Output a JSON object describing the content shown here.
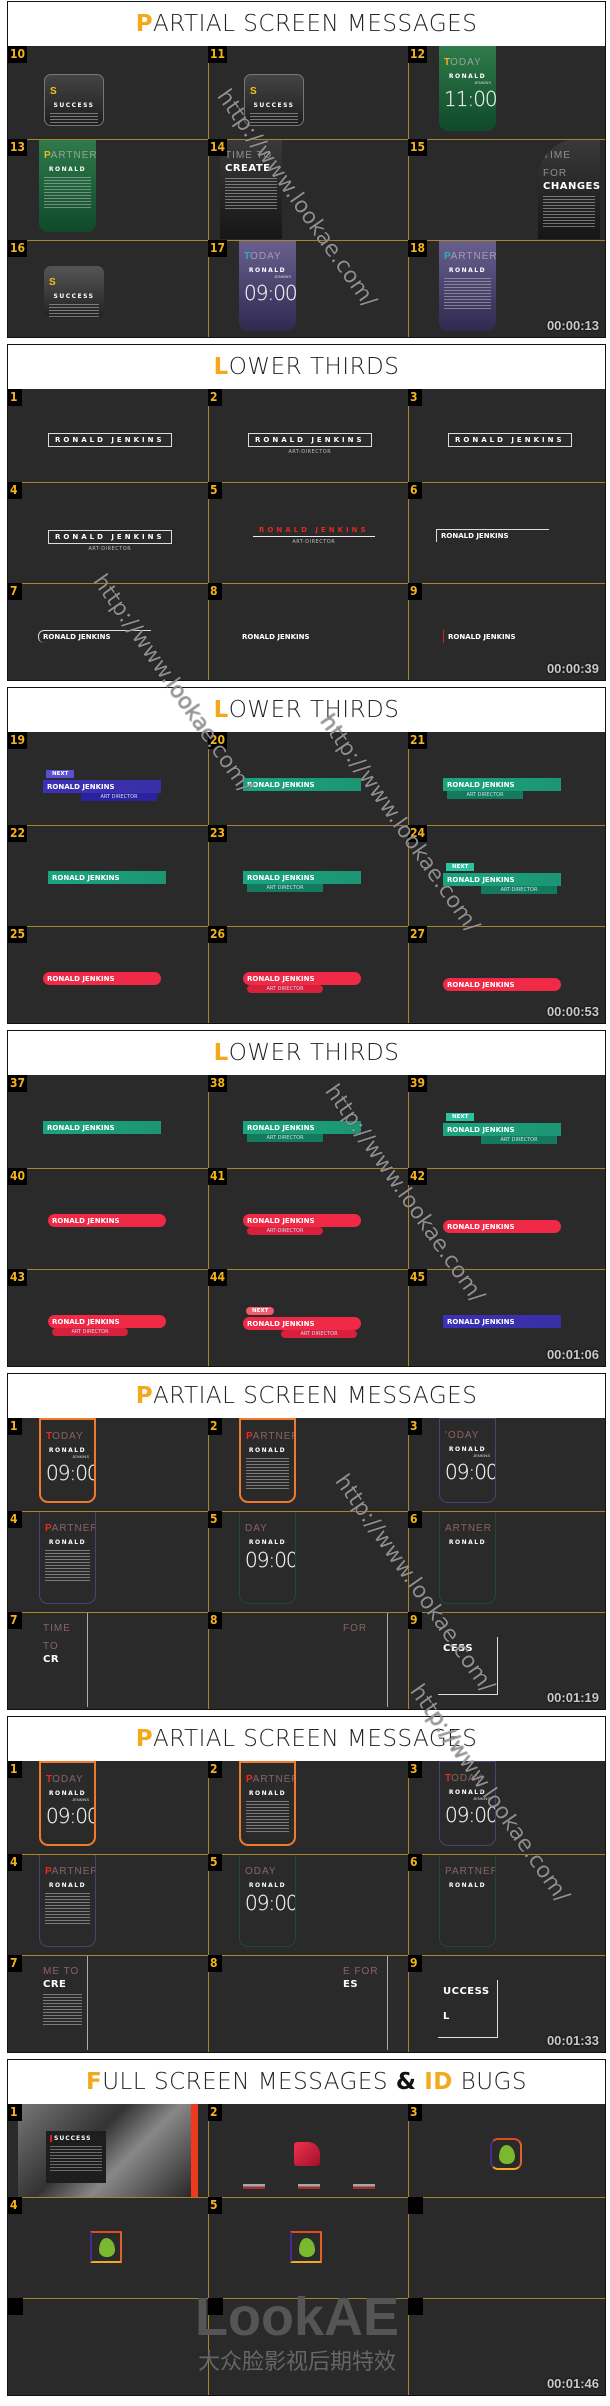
{
  "colors": {
    "accent": "#f4a81c",
    "grid_line": "#a8852c",
    "cell_bg": "#2a2a2a",
    "green": "#1aa57e",
    "blue": "#3b30b8",
    "red": "#f02a46",
    "orange": "#f07a2a",
    "purple": "#4a4470"
  },
  "watermark": {
    "url": "http://www.lookae.com/",
    "logo": "LookAE",
    "logo_sub": "大众脸影视后期特效"
  },
  "sections": [
    {
      "heading": [
        {
          "t": "P",
          "s": "accent"
        },
        {
          "t": "ARTIAL SCREEN MESSAGES",
          "s": "plain"
        }
      ],
      "timestamp": "00:00:13",
      "cells": [
        {
          "n": "10",
          "kind": "card",
          "theme": "dark",
          "ha": "S",
          "hr": "",
          "title": "SUCCESS",
          "para": true
        },
        {
          "n": "11",
          "kind": "card",
          "theme": "dark",
          "ha": "S",
          "title": "SUCCESS",
          "para": true
        },
        {
          "n": "12",
          "kind": "card",
          "theme": "green",
          "ha": "T",
          "hr": "ODAY",
          "title": "RONALD",
          "sub": "JENKINS",
          "time": "11:00"
        },
        {
          "n": "13",
          "kind": "card",
          "theme": "green",
          "ha": "P",
          "hr": "ARTNER",
          "title": "RONALD",
          "para": true
        },
        {
          "n": "14",
          "kind": "card",
          "theme": "black",
          "hr": "TIME TO",
          "big": "CREATE",
          "para": true
        },
        {
          "n": "15",
          "kind": "card",
          "theme": "black",
          "hr": "TIME FOR",
          "big": "CHANGES",
          "para": true
        },
        {
          "n": "16",
          "kind": "card",
          "theme": "gray",
          "ha": "S",
          "title": "SUCCESS",
          "para": true
        },
        {
          "n": "17",
          "kind": "card",
          "theme": "purple",
          "ha": "T",
          "hr": "ODAY",
          "title": "RONALD",
          "sub": "JENKINS",
          "time": "09:00"
        },
        {
          "n": "18",
          "kind": "card",
          "theme": "purple",
          "ha": "P",
          "hr": "ARTNER",
          "title": "RONALD",
          "para": true
        }
      ]
    },
    {
      "heading": [
        {
          "t": "L",
          "s": "accent"
        },
        {
          "t": "OWER THIRDS",
          "s": "plain"
        }
      ],
      "timestamp": "00:00:39",
      "cells": [
        {
          "n": "1",
          "kind": "lower",
          "style": "box",
          "name": "RONALD JENKINS"
        },
        {
          "n": "2",
          "kind": "lower",
          "style": "box",
          "name": "RONALD JENKINS",
          "sub": "ART-DIRECTOR"
        },
        {
          "n": "3",
          "kind": "lower",
          "style": "box",
          "name": "RONALD JENKINS"
        },
        {
          "n": "4",
          "kind": "lower",
          "style": "box",
          "name": "RONALD JENKINS",
          "sub": "ART-DIRECTOR"
        },
        {
          "n": "5",
          "kind": "lower",
          "style": "redtext",
          "name": "RONALD JENKINS",
          "sub": "ART-DIRECTOR"
        },
        {
          "n": "6",
          "kind": "lower",
          "style": "line",
          "name": "RONALD JENKINS"
        },
        {
          "n": "7",
          "kind": "lower",
          "style": "line",
          "name": "RONALD JENKINS"
        },
        {
          "n": "8",
          "kind": "lower",
          "style": "plain",
          "name": "RONALD JENKINS"
        },
        {
          "n": "9",
          "kind": "lower",
          "style": "redmark",
          "name": "RONALD JENKINS"
        }
      ]
    },
    {
      "heading": [
        {
          "t": "L",
          "s": "accent"
        },
        {
          "t": "OWER THIRDS",
          "s": "plain"
        }
      ],
      "timestamp": "00:00:53",
      "cells": [
        {
          "n": "19",
          "kind": "lower",
          "style": "bar",
          "color": "blue",
          "name": "RONALD JENKINS",
          "sub": "ART DIRECTOR",
          "next": "NEXT"
        },
        {
          "n": "20",
          "kind": "lower",
          "style": "bar",
          "color": "green",
          "name": "RONALD JENKINS"
        },
        {
          "n": "21",
          "kind": "lower",
          "style": "bar",
          "color": "green",
          "name": "RONALD JENKINS",
          "sub": "ART DIRECTOR"
        },
        {
          "n": "22",
          "kind": "lower",
          "style": "bar",
          "color": "green",
          "name": "RONALD JENKINS"
        },
        {
          "n": "23",
          "kind": "lower",
          "style": "bar",
          "color": "green",
          "name": "RONALD JENKINS",
          "sub": "ART DIRECTOR"
        },
        {
          "n": "24",
          "kind": "lower",
          "style": "bar",
          "color": "green",
          "name": "RONALD JENKINS",
          "sub": "ART-DIRECTOR",
          "next": "NEXT"
        },
        {
          "n": "25",
          "kind": "lower",
          "style": "bar",
          "color": "red",
          "name": "RONALD JENKINS",
          "tab": "pill"
        },
        {
          "n": "26",
          "kind": "lower",
          "style": "bar",
          "color": "red",
          "name": "RONALD JENKINS",
          "sub": "ART DIRECTOR",
          "tab": "pill"
        },
        {
          "n": "27",
          "kind": "lower",
          "style": "bar",
          "color": "red",
          "name": "RONALD JENKINS",
          "tab": "pill"
        }
      ]
    },
    {
      "heading": [
        {
          "t": "L",
          "s": "accent"
        },
        {
          "t": "OWER THIRDS",
          "s": "plain"
        }
      ],
      "timestamp": "00:01:06",
      "cells": [
        {
          "n": "37",
          "kind": "lower",
          "style": "bar",
          "color": "green",
          "name": "RONALD JENKINS",
          "tab": "white"
        },
        {
          "n": "38",
          "kind": "lower",
          "style": "bar",
          "color": "green",
          "name": "RONALD JENKINS",
          "sub": "ART DIRECTOR",
          "tab": "white"
        },
        {
          "n": "39",
          "kind": "lower",
          "style": "bar",
          "color": "green",
          "name": "RONALD JENKINS",
          "sub": "ART DIRECTOR",
          "next": "NEXT",
          "tab": "white"
        },
        {
          "n": "40",
          "kind": "lower",
          "style": "bar",
          "color": "red",
          "name": "RONALD JENKINS",
          "tab": "icon"
        },
        {
          "n": "41",
          "kind": "lower",
          "style": "bar",
          "color": "red",
          "name": "RONALD JENKINS",
          "sub": "ART-DIRECTOR",
          "tab": "icon"
        },
        {
          "n": "42",
          "kind": "lower",
          "style": "bar",
          "color": "red",
          "name": "RONALD JENKINS",
          "tab": "icon"
        },
        {
          "n": "43",
          "kind": "lower",
          "style": "bar",
          "color": "red",
          "name": "RONALD JENKINS",
          "sub": "ART DIRECTOR",
          "tab": "icon"
        },
        {
          "n": "44",
          "kind": "lower",
          "style": "bar",
          "color": "red",
          "name": "RONALD JENKINS",
          "sub": "ART DIRECTOR",
          "next": "NEXT",
          "tab": "icon"
        },
        {
          "n": "45",
          "kind": "lower",
          "style": "bar",
          "color": "blue",
          "name": "RONALD JENKINS",
          "tab": "leaf"
        }
      ]
    },
    {
      "heading": [
        {
          "t": "P",
          "s": "accent"
        },
        {
          "t": "ARTIAL SCREEN MESSAGES",
          "s": "plain"
        }
      ],
      "timestamp": "00:01:19",
      "cells": [
        {
          "n": "1",
          "kind": "card",
          "theme": "o-orange",
          "ha": "T",
          "hr": "ODAY",
          "title": "RONALD",
          "sub": "JENKINS",
          "time": "09:00"
        },
        {
          "n": "2",
          "kind": "card",
          "theme": "o-orange",
          "ha": "P",
          "hr": "ARTNER",
          "title": "RONALD",
          "para": true
        },
        {
          "n": "3",
          "kind": "card",
          "theme": "o-purple",
          "hr": "'ODAY",
          "title": "RONALD",
          "sub": "JENKINS",
          "time": "09:00"
        },
        {
          "n": "4",
          "kind": "card",
          "theme": "o-purple",
          "ha": "P",
          "hr": "ARTNER",
          "title": "RONALD",
          "para": true
        },
        {
          "n": "5",
          "kind": "card",
          "theme": "o-green",
          "hr": "DAY",
          "title": "RONALD",
          "time": "09:00"
        },
        {
          "n": "6",
          "kind": "card",
          "theme": "o-green",
          "hr": "ARTNER",
          "title": "RONALD"
        },
        {
          "n": "7",
          "kind": "card",
          "theme": "o-line",
          "hr": "TIME TO",
          "big": "CR"
        },
        {
          "n": "8",
          "kind": "card",
          "theme": "o-line",
          "hr": "FOR"
        },
        {
          "n": "9",
          "kind": "card",
          "theme": "o-corner",
          "big": "CESS"
        }
      ]
    },
    {
      "heading": [
        {
          "t": "P",
          "s": "accent"
        },
        {
          "t": "ARTIAL SCREEN MESSAGES",
          "s": "plain"
        }
      ],
      "timestamp": "00:01:33",
      "cells": [
        {
          "n": "1",
          "kind": "card",
          "theme": "o-orange",
          "ha": "T",
          "hr": "ODAY",
          "title": "RONALD",
          "sub": "JENKINS",
          "time": "09:00"
        },
        {
          "n": "2",
          "kind": "card",
          "theme": "o-orange",
          "ha": "P",
          "hr": "ARTNER",
          "title": "RONALD",
          "para": true
        },
        {
          "n": "3",
          "kind": "card",
          "theme": "o-purple",
          "ha": "T",
          "hr": "ODAY",
          "title": "RONALD",
          "sub": "JENKINS",
          "time": "09:00"
        },
        {
          "n": "4",
          "kind": "card",
          "theme": "o-purple",
          "ha": "P",
          "hr": "ARTNER",
          "title": "RONALD",
          "para": true
        },
        {
          "n": "5",
          "kind": "card",
          "theme": "o-green",
          "hr": "ODAY",
          "title": "RONALD",
          "time": "09:00"
        },
        {
          "n": "6",
          "kind": "card",
          "theme": "o-green",
          "hr": "PARTNER",
          "title": "RONALD"
        },
        {
          "n": "7",
          "kind": "card",
          "theme": "o-line",
          "hr": "ME TO",
          "big": "CRE",
          "para": true
        },
        {
          "n": "8",
          "kind": "card",
          "theme": "o-line",
          "hr": "E FOR",
          "big": "ES"
        },
        {
          "n": "9",
          "kind": "card",
          "theme": "o-corner",
          "big": "UCCESS",
          "tail": "L"
        }
      ]
    },
    {
      "heading": [
        {
          "t": "F",
          "s": "accent"
        },
        {
          "t": "ULL SCREEN MESSAGES ",
          "s": "plain"
        },
        {
          "t": "&",
          "s": "bold"
        },
        {
          "t": " ",
          "s": "plain"
        },
        {
          "t": "ID",
          "s": "accent"
        },
        {
          "t": " BUGS",
          "s": "plain"
        }
      ],
      "timestamp": "00:01:46",
      "cells": [
        {
          "n": "1",
          "kind": "photo",
          "title": "SUCCESS"
        },
        {
          "n": "2",
          "kind": "redlogo"
        },
        {
          "n": "3",
          "kind": "leaf"
        },
        {
          "n": "4",
          "kind": "leaf"
        },
        {
          "n": "5",
          "kind": "leaf"
        },
        {
          "n": "",
          "kind": "empty"
        },
        {
          "n": "",
          "kind": "empty"
        },
        {
          "n": "",
          "kind": "empty"
        },
        {
          "n": "",
          "kind": "empty"
        }
      ]
    }
  ]
}
